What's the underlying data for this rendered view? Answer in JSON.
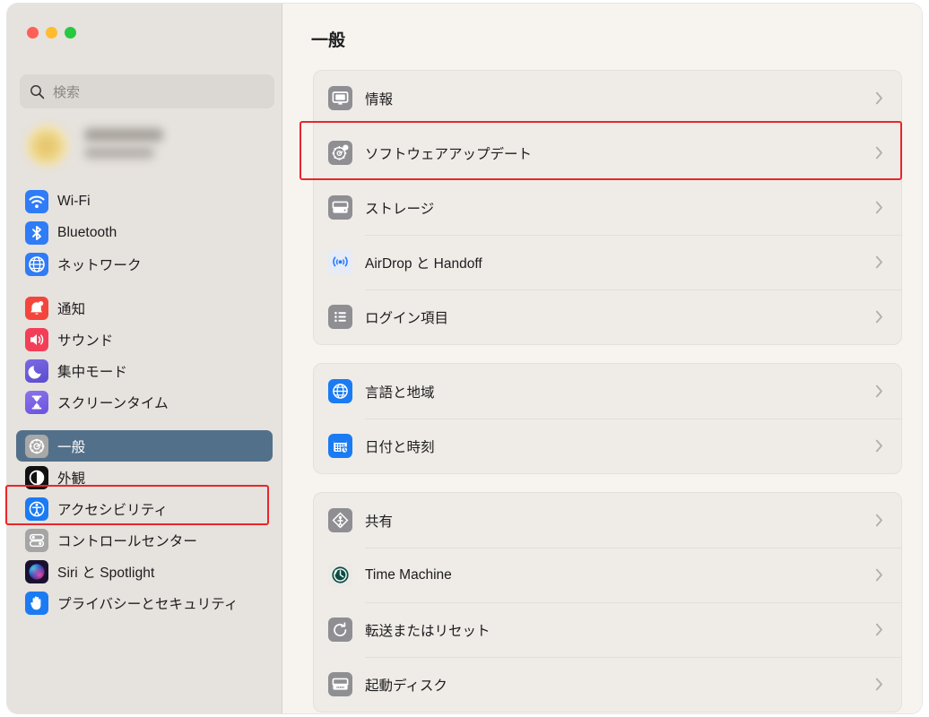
{
  "window": {
    "traffic_lights": [
      {
        "name": "close",
        "color": "#ff5f57"
      },
      {
        "name": "minimize",
        "color": "#febc2e"
      },
      {
        "name": "maximize",
        "color": "#28c840"
      }
    ]
  },
  "search": {
    "placeholder": "検索",
    "value": "",
    "icon": "search-icon"
  },
  "profile": {
    "redacted": true,
    "avatar_icon": "avatar",
    "name_redacted": "",
    "subtitle_redacted": ""
  },
  "sidebar": {
    "selected": "一般",
    "selected_color": "#53708a",
    "groups": [
      {
        "items": [
          {
            "label": "Wi-Fi",
            "icon": "wifi-icon",
            "color": "#2f7cf6"
          },
          {
            "label": "Bluetooth",
            "icon": "bluetooth-icon",
            "color": "#2f7cf6"
          },
          {
            "label": "ネットワーク",
            "icon": "network-globe-icon",
            "color": "#2f7cf6"
          }
        ]
      },
      {
        "items": [
          {
            "label": "通知",
            "icon": "notifications-bell-icon",
            "color": "#f4453c"
          },
          {
            "label": "サウンド",
            "icon": "sound-speaker-icon",
            "color": "#f33e58"
          },
          {
            "label": "集中モード",
            "icon": "focus-moon-icon",
            "color": "#6558d8"
          },
          {
            "label": "スクリーンタイム",
            "icon": "screentime-hourglass-icon",
            "color": "#7a63e0"
          }
        ]
      },
      {
        "items": [
          {
            "label": "一般",
            "icon": "general-gear-icon",
            "color": "#9b9b9b",
            "selected": true
          },
          {
            "label": "外観",
            "icon": "appearance-contrast-icon",
            "color": "#111111"
          },
          {
            "label": "アクセシビリティ",
            "icon": "accessibility-person-icon",
            "color": "#1b7bf2"
          },
          {
            "label": "コントロールセンター",
            "icon": "control-center-toggles-icon",
            "color": "#a0a0a0"
          },
          {
            "label": "Siri と Spotlight",
            "icon": "siri-orb-icon",
            "color": "#6e4aa8"
          },
          {
            "label": "プライバシーとセキュリティ",
            "icon": "privacy-hand-icon",
            "color": "#1b7bf2"
          }
        ]
      }
    ]
  },
  "main": {
    "title": "一般",
    "cards": [
      {
        "rows": [
          {
            "label": "情報",
            "icon": "info-display-icon",
            "color": "#8e8e93",
            "chevron": "chevron-right-icon"
          },
          {
            "label": "ソフトウェアアップデート",
            "icon": "software-update-gear-icon",
            "color": "#8e8e93",
            "chevron": "chevron-right-icon",
            "highlighted": true
          },
          {
            "label": "ストレージ",
            "icon": "storage-drive-icon",
            "color": "#8e8e93",
            "chevron": "chevron-right-icon"
          },
          {
            "label": "AirDrop と Handoff",
            "icon": "airdrop-icon",
            "color": "#e8eef8",
            "chevron": "chevron-right-icon"
          },
          {
            "label": "ログイン項目",
            "icon": "login-items-list-icon",
            "color": "#8e8e93",
            "chevron": "chevron-right-icon"
          }
        ]
      },
      {
        "rows": [
          {
            "label": "言語と地域",
            "icon": "language-globe-icon",
            "color": "#1b7bf2",
            "chevron": "chevron-right-icon"
          },
          {
            "label": "日付と時刻",
            "icon": "date-time-calendar-icon",
            "color": "#1b7bf2",
            "chevron": "chevron-right-icon"
          }
        ]
      },
      {
        "rows": [
          {
            "label": "共有",
            "icon": "sharing-icon",
            "color": "#8e8e93",
            "chevron": "chevron-right-icon"
          },
          {
            "label": "Time Machine",
            "icon": "time-machine-icon",
            "color": "#e9e5e1",
            "chevron": "chevron-right-icon"
          },
          {
            "label": "転送またはリセット",
            "icon": "transfer-reset-icon",
            "color": "#8e8e93",
            "chevron": "chevron-right-icon"
          },
          {
            "label": "起動ディスク",
            "icon": "startup-disk-icon",
            "color": "#8e8e93",
            "chevron": "chevron-right-icon"
          }
        ]
      }
    ]
  },
  "annotations": {
    "color": "#e8262b",
    "boxes": [
      {
        "target": "sidebar-item-general"
      },
      {
        "target": "row-software-update"
      }
    ]
  }
}
